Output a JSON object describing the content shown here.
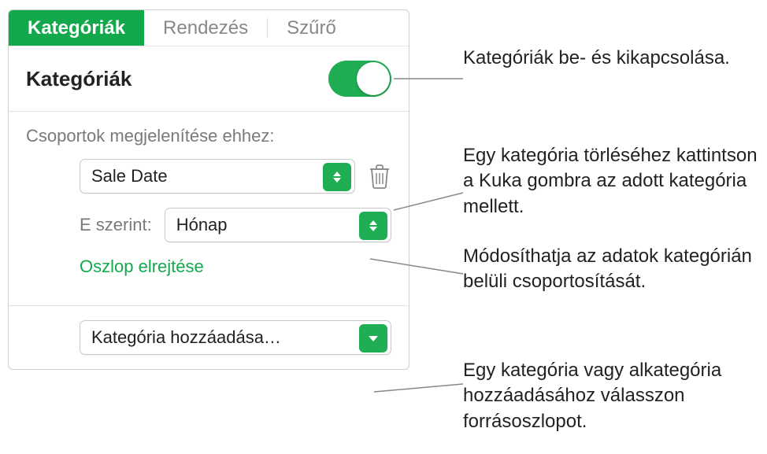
{
  "tabs": {
    "categories": "Kategóriák",
    "sort": "Rendezés",
    "filter": "Szűrő"
  },
  "header": {
    "title": "Kategóriák"
  },
  "groups": {
    "label": "Csoportok megjelenítése ehhez:",
    "category_value": "Sale Date",
    "by_label": "E szerint:",
    "by_value": "Hónap",
    "hide_column": "Oszlop elrejtése"
  },
  "add": {
    "label": "Kategória hozzáadása…"
  },
  "callouts": {
    "toggle": "Kategóriák be- és kikapcsolása.",
    "trash": "Egy kategória törléséhez kattintson a Kuka gombra az adott kategória mellett.",
    "grouping": "Módosíthatja az adatok kategórián belüli csoportosítását.",
    "add": "Egy kategória vagy alkategória hozzáadásához válasszon forrásoszlopot."
  }
}
